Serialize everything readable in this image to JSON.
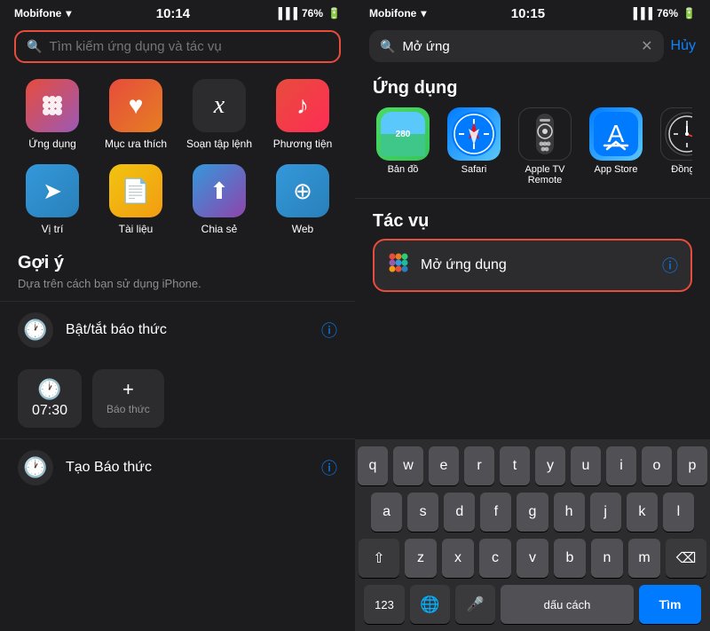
{
  "left": {
    "status": {
      "carrier": "Mobifone",
      "time": "10:14",
      "battery": "76%"
    },
    "search": {
      "placeholder": "Tìm kiếm ứng dụng và tác vụ"
    },
    "shortcuts": [
      {
        "id": "apps",
        "emoji": "⊞",
        "label": "Ứng dụng",
        "class": "ic-apps"
      },
      {
        "id": "favorites",
        "emoji": "♥",
        "label": "Mục ưa thích",
        "class": "ic-favorites"
      },
      {
        "id": "shortcuts",
        "emoji": "✕",
        "label": "Soạn tập lệnh",
        "class": "ic-shortcuts"
      },
      {
        "id": "media",
        "emoji": "♪",
        "label": "Phương tiện",
        "class": "ic-media"
      },
      {
        "id": "location",
        "emoji": "➤",
        "label": "Vị trí",
        "class": "ic-location"
      },
      {
        "id": "documents",
        "emoji": "📄",
        "label": "Tài liệu",
        "class": "ic-documents"
      },
      {
        "id": "share",
        "emoji": "⬆",
        "label": "Chia sẻ",
        "class": "ic-share"
      },
      {
        "id": "web",
        "emoji": "⊕",
        "label": "Web",
        "class": "ic-web"
      }
    ],
    "section": {
      "title": "Gợi ý",
      "subtitle": "Dựa trên cách bạn sử dụng iPhone."
    },
    "suggestions": [
      {
        "id": "alarm-toggle",
        "icon": "🕐",
        "label": "Bật/tắt báo thức"
      }
    ],
    "alarmChips": [
      {
        "time": "07:30",
        "label": ""
      },
      {
        "plus": "+",
        "label": "Báo thức"
      }
    ],
    "suggestion2": {
      "icon": "🕐",
      "label": "Tạo Báo thức"
    }
  },
  "right": {
    "status": {
      "carrier": "Mobifone",
      "time": "10:15",
      "battery": "76%"
    },
    "search": {
      "value": "Mở ứng",
      "cancel_label": "Hủy"
    },
    "apps_section_title": "Ứng dụng",
    "apps": [
      {
        "id": "maps",
        "label": "Bản đồ"
      },
      {
        "id": "safari",
        "label": "Safari"
      },
      {
        "id": "tv-remote",
        "label": "Apple TV Remote"
      },
      {
        "id": "appstore",
        "label": "App Store"
      },
      {
        "id": "clock",
        "label": "Đồng..."
      }
    ],
    "tasks_section_title": "Tác vụ",
    "task": {
      "icon": "⊞",
      "label": "Mở ứng dụng"
    },
    "keyboard": {
      "rows": [
        [
          "q",
          "w",
          "e",
          "r",
          "t",
          "y",
          "u",
          "i",
          "o",
          "p"
        ],
        [
          "a",
          "s",
          "d",
          "f",
          "g",
          "h",
          "j",
          "k",
          "l"
        ],
        [
          "z",
          "x",
          "c",
          "v",
          "b",
          "n",
          "m"
        ],
        [
          "123",
          "🌐",
          "🎤",
          "dấu cách",
          "Tìm"
        ]
      ],
      "cancel": "Hủy",
      "find": "Tìm",
      "space": "dấu cách"
    }
  }
}
